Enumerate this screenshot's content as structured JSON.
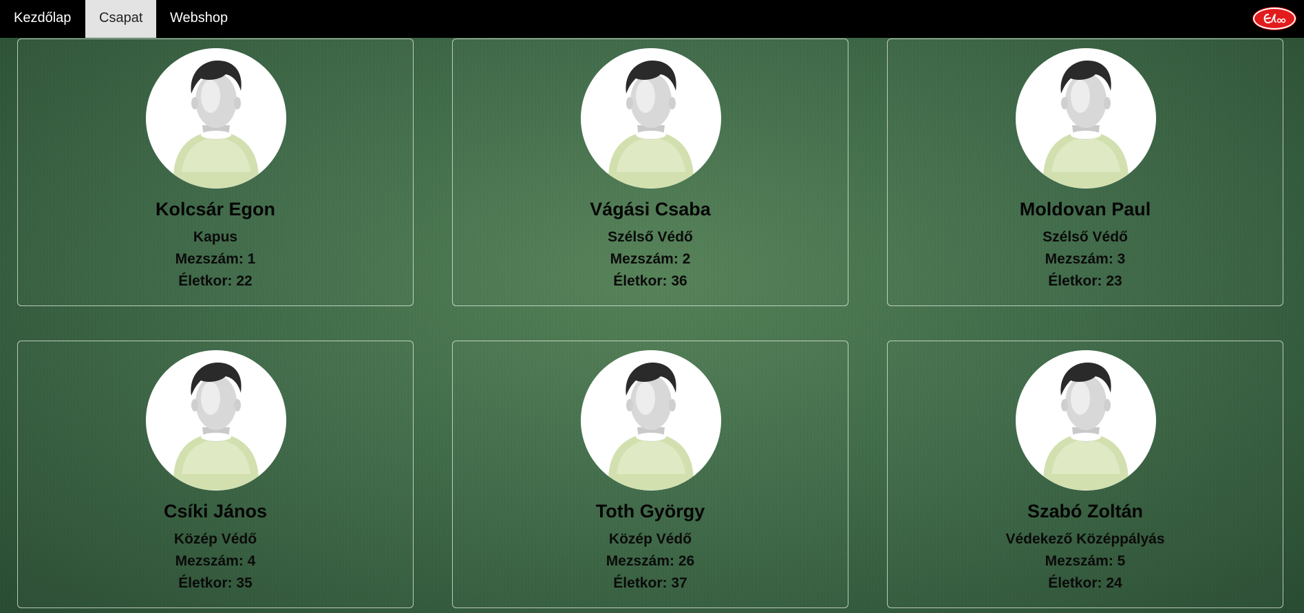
{
  "nav": {
    "items": [
      {
        "label": "Kezdőlap",
        "active": false
      },
      {
        "label": "Csapat",
        "active": true
      },
      {
        "label": "Webshop",
        "active": false
      }
    ],
    "logo_icon": "club-logo-icon"
  },
  "labels": {
    "jersey_prefix": "Mezszám: ",
    "age_prefix": "Életkor: "
  },
  "colors": {
    "nav_background": "#000000",
    "active_tab": "#e3e3e3",
    "logo": "#e21c1c"
  },
  "players": [
    {
      "name": "Kolcsár Egon",
      "position": "Kapus",
      "jersey": "Mezszám: 1",
      "age": "Életkor: 22"
    },
    {
      "name": "Vágási Csaba",
      "position": "Szélső Védő",
      "jersey": "Mezszám: 2",
      "age": "Életkor: 36"
    },
    {
      "name": "Moldovan Paul",
      "position": "Szélső Védő",
      "jersey": "Mezszám: 3",
      "age": "Életkor: 23"
    },
    {
      "name": "Csíki János",
      "position": "Közép Védő",
      "jersey": "Mezszám: 4",
      "age": "Életkor: 35"
    },
    {
      "name": "Toth György",
      "position": "Közép Védő",
      "jersey": "Mezszám: 26",
      "age": "Életkor: 37"
    },
    {
      "name": "Szabó Zoltán",
      "position": "Védekező Középpályás",
      "jersey": "Mezszám: 5",
      "age": "Életkor: 24"
    }
  ]
}
